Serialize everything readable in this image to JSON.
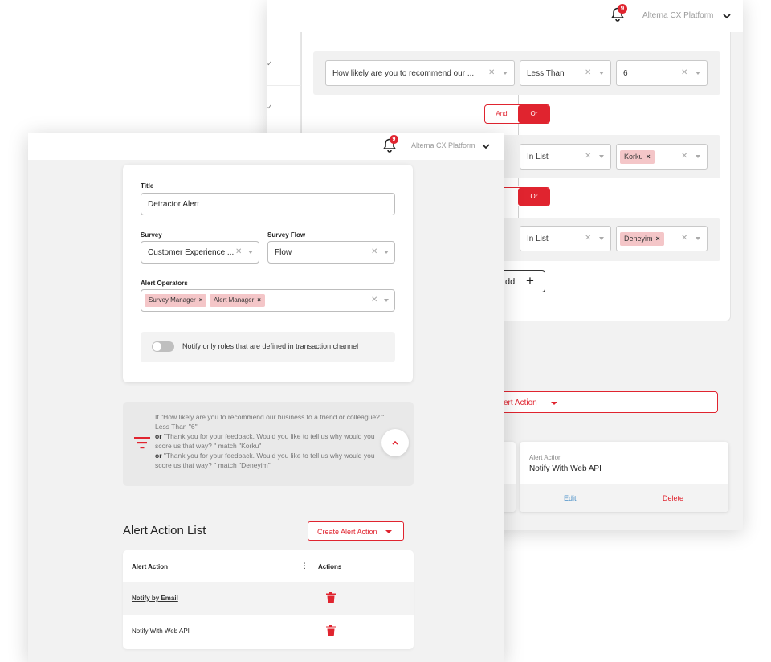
{
  "header": {
    "platform_name": "Alterna CX Platform",
    "notification_count": "9"
  },
  "back_window": {
    "rules": [
      {
        "question": "How likely are you to recommend our ...",
        "operator": "Less Than",
        "value_text": "6",
        "tag": ""
      },
      {
        "question": "",
        "operator": "In List",
        "value_text": "",
        "tag": "Korku"
      },
      {
        "question": "",
        "operator": "In List",
        "value_text": "",
        "tag": "Deneyim"
      }
    ],
    "and_label": "And",
    "or_label": "Or",
    "partial_and_label": "l",
    "add_label": "dd",
    "add_icon": "+",
    "alert_action_button_label": "ert Action",
    "action_card": {
      "label": "Alert Action",
      "value": "Notify With Web API",
      "edit_label": "Edit",
      "delete_label": "Delete"
    }
  },
  "form": {
    "title_label": "Title",
    "title_value": "Detractor Alert",
    "survey_label": "Survey",
    "survey_value": "Customer Experience ...",
    "survey_flow_label": "Survey Flow",
    "survey_flow_value": "Flow",
    "alert_operators_label": "Alert Operators",
    "operators": [
      "Survey Manager",
      "Alert Manager"
    ],
    "notify_toggle_label": "Notify only roles that are defined in transaction channel",
    "notify_toggle_on": false
  },
  "summary": {
    "line1": "If \"How likely are you to recommend our business to a friend or colleague? \" Less Than \"6\"",
    "or1": "or",
    "line2": " \"Thank you for your feedback. Would you like to tell us why would you score us that way? \" match \"Korku\"",
    "or2": "or",
    "line3": " \"Thank you for your feedback. Would you like to tell us why would you score us that way? \" match \"Deneyim\""
  },
  "alert_action_list": {
    "title": "Alert Action List",
    "create_button_label": "Create Alert Action",
    "col_alert_action": "Alert Action",
    "col_actions": "Actions",
    "rows": [
      {
        "name": "Notify by Email"
      },
      {
        "name": "Notify With Web API"
      }
    ]
  },
  "colors": {
    "accent_red": "#e0242f",
    "tag_pink": "#f4c6c8",
    "link_blue": "#4a90c8"
  },
  "icons": {
    "bell": "bell-icon",
    "chevron": "chevron-down-icon",
    "filter": "filter-icon",
    "trash": "trash-icon",
    "collapse": "chevron-up-icon"
  }
}
